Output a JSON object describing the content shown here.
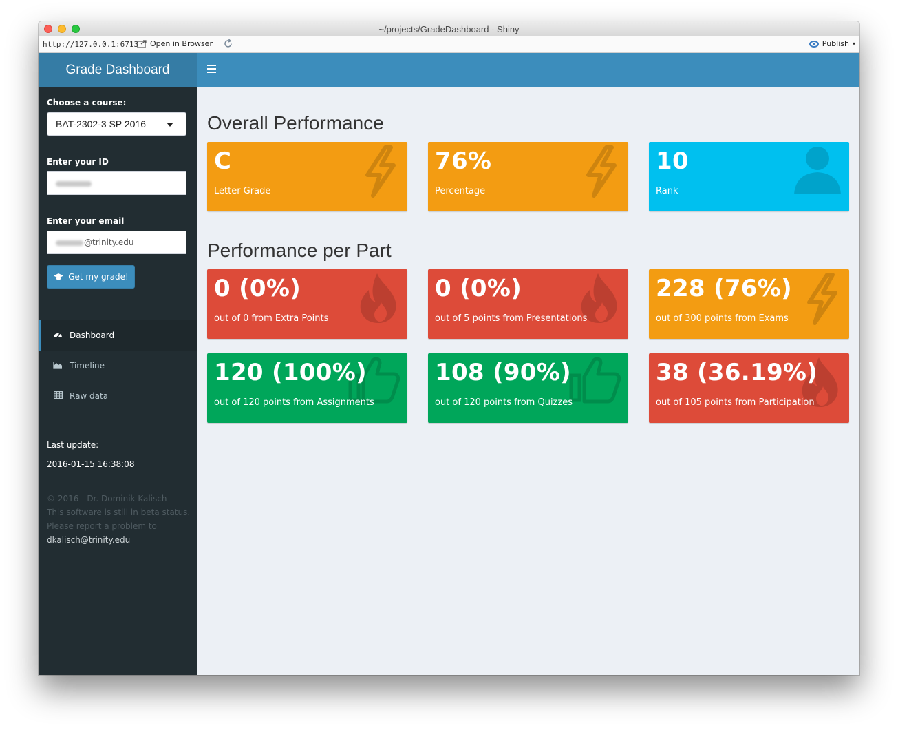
{
  "window": {
    "title": "~/projects/GradeDashboard - Shiny"
  },
  "toolbar": {
    "url": "http://127.0.0.1:6713",
    "open_in_browser": "Open in Browser",
    "publish": "Publish"
  },
  "header": {
    "logo": "Grade Dashboard"
  },
  "sidebar": {
    "course_label": "Choose a course:",
    "course_value": "BAT-2302-3 SP 2016",
    "id_label": "Enter your ID",
    "email_label": "Enter your email",
    "email_suffix": "@trinity.edu",
    "button_label": "Get my grade!",
    "menu": [
      {
        "label": "Dashboard",
        "icon": "dashboard-icon",
        "active": true
      },
      {
        "label": "Timeline",
        "icon": "area-chart-icon",
        "active": false
      },
      {
        "label": "Raw data",
        "icon": "table-icon",
        "active": false
      }
    ],
    "last_update_label": "Last update:",
    "last_update_value": "2016-01-15 16:38:08",
    "footer_line1": "© 2016 - Dr. Dominik Kalisch",
    "footer_line2": "This software is still in beta status.",
    "footer_line3": "Please report a problem to",
    "footer_email": "dkalisch@trinity.edu"
  },
  "overall": {
    "title": "Overall Performance",
    "boxes": [
      {
        "value": "C",
        "subtitle": "Letter Grade",
        "color": "#f39c12",
        "icon": "bolt-icon"
      },
      {
        "value": "76%",
        "subtitle": "Percentage",
        "color": "#f39c12",
        "icon": "bolt-icon"
      },
      {
        "value": "10",
        "subtitle": "Rank",
        "color": "#00c0ef",
        "icon": "user-icon"
      }
    ]
  },
  "parts": {
    "title": "Performance per Part",
    "boxes": [
      {
        "value": "0 (0%)",
        "subtitle": "out of 0 from Extra Points",
        "color": "#dd4b39",
        "icon": "fire-icon"
      },
      {
        "value": "0 (0%)",
        "subtitle": "out of 5 points from Presentations",
        "color": "#dd4b39",
        "icon": "fire-icon"
      },
      {
        "value": "228 (76%)",
        "subtitle": "out of 300 points from Exams",
        "color": "#f39c12",
        "icon": "bolt-icon"
      },
      {
        "value": "120 (100%)",
        "subtitle": "out of 120 points from Assignments",
        "color": "#00a65a",
        "icon": "thumbs-up-icon"
      },
      {
        "value": "108 (90%)",
        "subtitle": "out of 120 points from Quizzes",
        "color": "#00a65a",
        "icon": "thumbs-up-icon"
      },
      {
        "value": "38 (36.19%)",
        "subtitle": "out of 105 points from Participation",
        "color": "#dd4b39",
        "icon": "fire-icon"
      }
    ]
  }
}
